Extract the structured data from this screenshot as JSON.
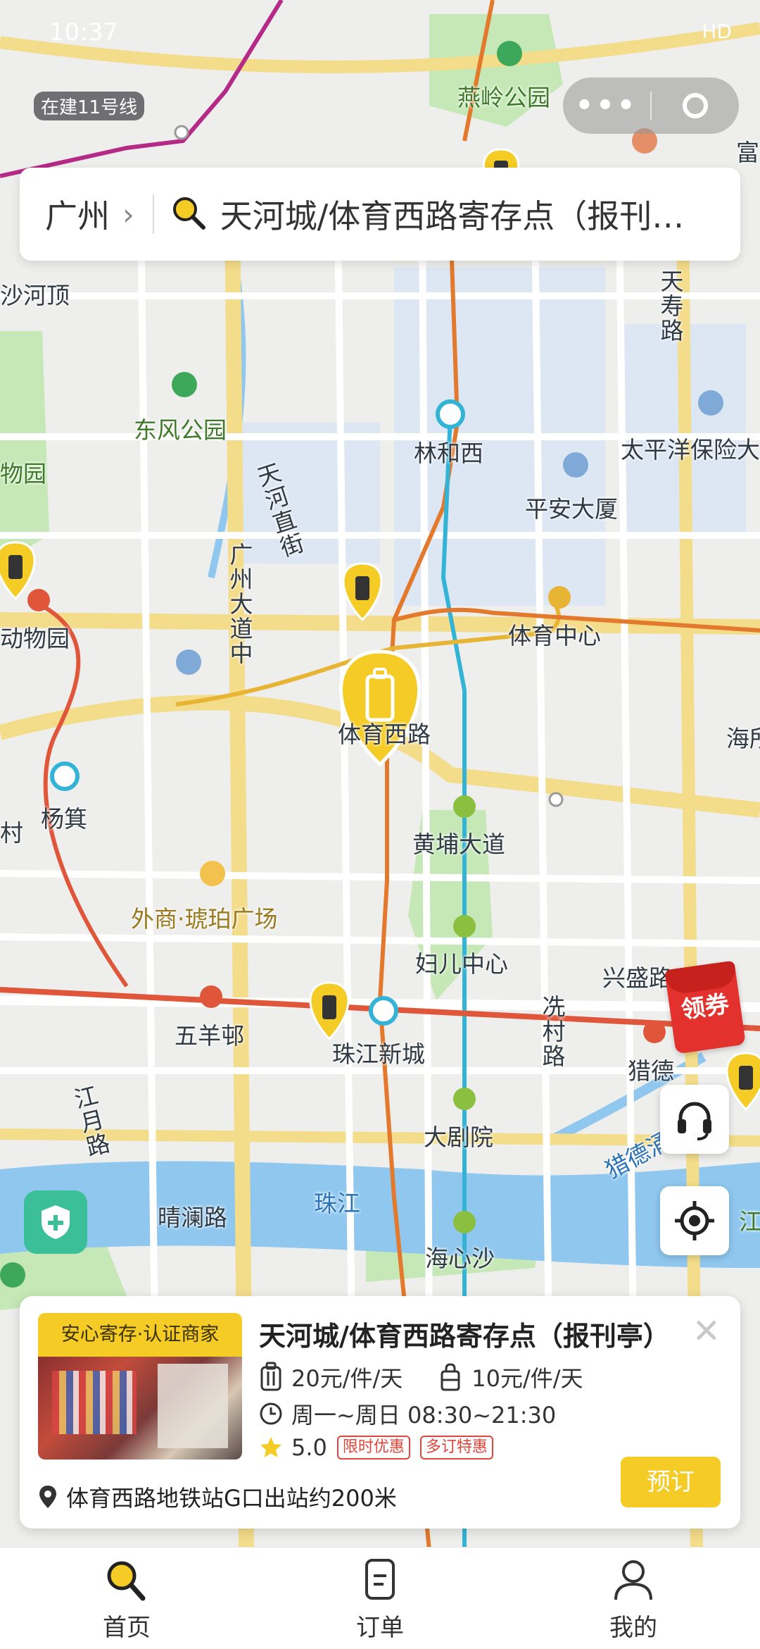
{
  "status_bar": {
    "time": "10:37",
    "right": "HD"
  },
  "map": {
    "labels": [
      {
        "text": "燕岭公园",
        "style": "green"
      },
      {
        "text": "在建11号线",
        "style": "small"
      },
      {
        "text": "沙河顶",
        "style": ""
      },
      {
        "text": "东风公园",
        "style": "green"
      },
      {
        "text": "物园",
        "style": "green"
      },
      {
        "text": "天河直街",
        "style": "vertical"
      },
      {
        "text": "林和西",
        "style": ""
      },
      {
        "text": "平安大厦",
        "style": ""
      },
      {
        "text": "太平洋保险大",
        "style": ""
      },
      {
        "text": "天寿路",
        "style": "vertical"
      },
      {
        "text": "广州大道中",
        "style": "vertical"
      },
      {
        "text": "体育中心",
        "style": ""
      },
      {
        "text": "动物园",
        "style": ""
      },
      {
        "text": "体育西路",
        "style": ""
      },
      {
        "text": "海所",
        "style": ""
      },
      {
        "text": "杨箕",
        "style": ""
      },
      {
        "text": "黄埔大道",
        "style": ""
      },
      {
        "text": "外商·琥珀广场",
        "style": "gold"
      },
      {
        "text": "妇儿中心",
        "style": ""
      },
      {
        "text": "兴盛路",
        "style": ""
      },
      {
        "text": "冼村路",
        "style": "vertical"
      },
      {
        "text": "五羊邨",
        "style": ""
      },
      {
        "text": "珠江新城",
        "style": ""
      },
      {
        "text": "猎德",
        "style": ""
      },
      {
        "text": "江月路",
        "style": "vertical"
      },
      {
        "text": "大剧院",
        "style": ""
      },
      {
        "text": "猎德涌",
        "style": "blue"
      },
      {
        "text": "晴澜路",
        "style": ""
      },
      {
        "text": "珠江",
        "style": "blue"
      },
      {
        "text": "海心沙",
        "style": ""
      },
      {
        "text": "富",
        "style": ""
      },
      {
        "text": "村",
        "style": ""
      },
      {
        "text": "江",
        "style": "green"
      }
    ]
  },
  "search": {
    "city": "广州",
    "query": "天河城/体育西路寄存点（报刊亭）"
  },
  "coupon": {
    "label": "领券"
  },
  "store": {
    "badge": "安心寄存·认证商家",
    "name": "天河城/体育西路寄存点（报刊亭）",
    "price_large": "20元/件/天",
    "price_small": "10元/件/天",
    "hours": "周一~周日 08:30~21:30",
    "rating": "5.0",
    "tags": [
      "限时优惠",
      "多订特惠"
    ],
    "address": "体育西路地铁站G口出站约200米",
    "book_label": "预订"
  },
  "tabs": [
    {
      "label": "首页",
      "icon": "search-icon",
      "active": true
    },
    {
      "label": "订单",
      "icon": "order-icon",
      "active": false
    },
    {
      "label": "我的",
      "icon": "profile-icon",
      "active": false
    }
  ],
  "colors": {
    "accent": "#f5cc25",
    "metro_red": "#e0563a",
    "metro_blue": "#33b3d6",
    "metro_orange": "#e2792c",
    "metro_gold": "#e7b533",
    "water": "#8fc7ef",
    "park": "#c5e8b6"
  }
}
